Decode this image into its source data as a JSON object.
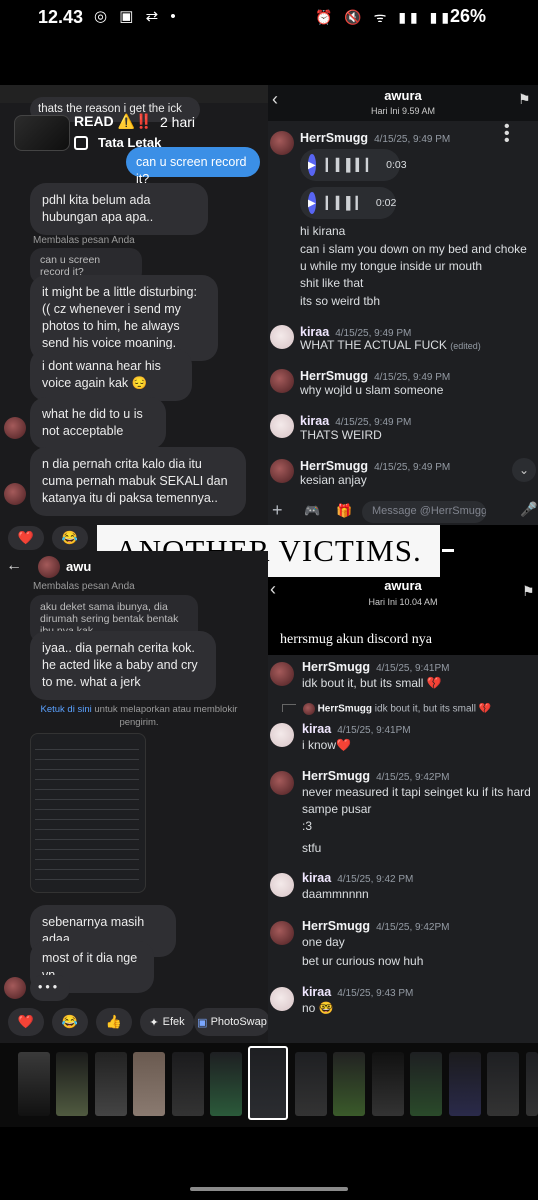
{
  "status_bar": {
    "time": "12.43",
    "battery": "26%",
    "icons": [
      "whatsapp-icon",
      "message-icon",
      "retweet-icon",
      "alarm-icon",
      "mute-icon",
      "wifi-icon",
      "signal-icon",
      "battery-icon"
    ]
  },
  "top_left": {
    "prev_message": "thats the reason i get the ick",
    "story_label": "READ ⚠️‼️",
    "story_age": "2 hari",
    "layout_label": "Tata Letak",
    "my_bubble": "can u screen record it?",
    "msgs": [
      "pdhl kita belum ada hubungan apa apa..",
      "it might be a little disturbing: (( cz whenever i send my photos to him, he always send his voice moaning.",
      "i dont wanna hear his voice again kak 😔",
      "what he did to u is not acceptable",
      "n dia pernah crita kalo dia itu cuma pernah mabuk SEKALI dan katanya itu di paksa temennya.."
    ],
    "reply_label": "Membalas pesan Anda",
    "reply_quote": "can u screen record it?"
  },
  "top_right": {
    "header_name": "awura",
    "header_sub": "Hari Ini 9.59 AM",
    "messages": [
      {
        "name": "HerrSmugg",
        "time": "4/15/25, 9:49 PM",
        "lines": [
          "hi kirana",
          "can i slam you down on my bed and choke u while my tongue inside ur mouth",
          "shit like that",
          "its so weird tbh"
        ]
      },
      {
        "name": "kiraa",
        "time": "4/15/25, 9:49 PM",
        "lines": [
          "WHAT THE ACTUAL FUCK"
        ],
        "edited": "(edited)"
      },
      {
        "name": "HerrSmugg",
        "time": "4/15/25, 9:49 PM",
        "lines": [
          "why wojld u slam someone"
        ]
      },
      {
        "name": "kiraa",
        "time": "4/15/25, 9:49 PM",
        "lines": [
          "THATS WEIRD"
        ]
      },
      {
        "name": "HerrSmugg",
        "time": "4/15/25, 9:49 PM",
        "lines": [
          "kesian anjay"
        ]
      }
    ],
    "voice": [
      {
        "duration": "0:03"
      },
      {
        "duration": "0:02"
      }
    ],
    "input_placeholder": "Message @HerrSmugg"
  },
  "banner": "ANOTHER VICTIMS.",
  "bottom_left": {
    "header_name": "awu",
    "reply_label": "Membalas pesan Anda",
    "reply_quote": "aku deket sama ibunya, dia dirumah sering bentak bentak ibu nya kak",
    "msgs": [
      "iyaa.. dia pernah cerita kok. he acted like a baby and cry to me. what a jerk",
      "sebenarnya masih adaa..",
      "most of it dia nge vn"
    ],
    "report_link": "Ketuk di sini",
    "report_text": "untuk melaporkan atau memblokir pengirim.",
    "reactions": [
      "❤️",
      "😂",
      "👍",
      "Efek",
      "PhotoSwap"
    ]
  },
  "bottom_right": {
    "header_name": "awura",
    "header_sub": "Hari Ini 10.04 AM",
    "caption": "herrsmug akun discord nya",
    "reply_preview_name": "HerrSmugg",
    "reply_preview_text": "idk bout it, but its small 💔",
    "messages": [
      {
        "name": "HerrSmugg",
        "time": "4/15/25, 9:41PM",
        "lines": [
          "idk bout it, but its small 💔"
        ]
      },
      {
        "name": "kiraa",
        "time": "4/15/25, 9:41PM",
        "lines": [
          "i know❤️"
        ]
      },
      {
        "name": "HerrSmugg",
        "time": "4/15/25, 9:42PM",
        "lines": [
          "never measured it tapi seinget ku if its hard sampe pusar",
          ":3",
          "stfu"
        ]
      },
      {
        "name": "kiraa",
        "time": "4/15/25, 9:42 PM",
        "lines": [
          "daammnnnn"
        ]
      },
      {
        "name": "HerrSmugg",
        "time": "4/15/25, 9:42PM",
        "lines": [
          "one day",
          "bet ur curious now huh"
        ]
      },
      {
        "name": "kiraa",
        "time": "4/15/25, 9:43 PM",
        "lines": [
          "no 🤓"
        ]
      }
    ]
  },
  "colors": {
    "ig_bg": "#1b1b1d",
    "discord_bg": "#1e1f22",
    "bubble": "#2f2f33",
    "accent_blue": "#3b8fe6",
    "discord_blurple": "#5865f2"
  }
}
